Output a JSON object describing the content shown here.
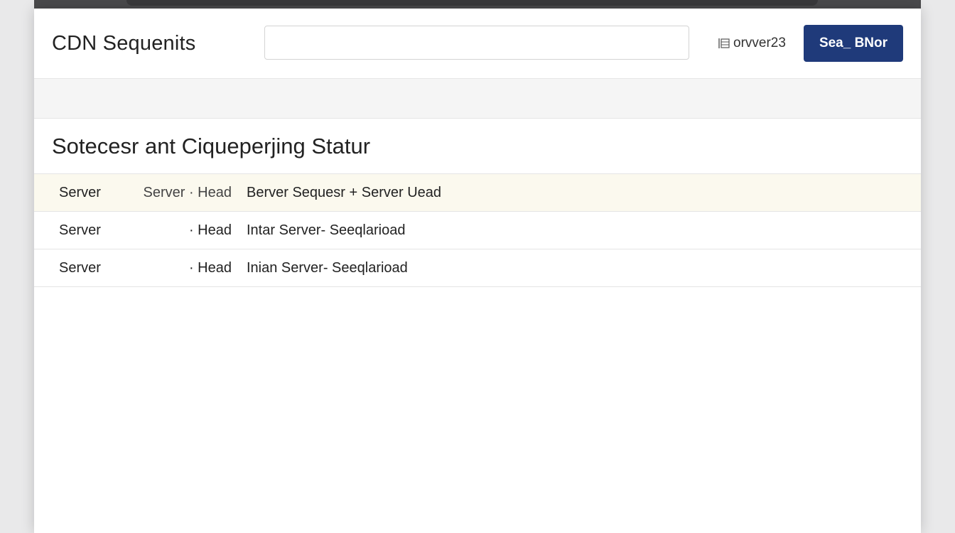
{
  "app": {
    "title": "CDN Sequenits"
  },
  "header": {
    "search_value": "",
    "server_label": "orvver23",
    "server_icon": "server-icon",
    "primary_button_label": "Sea_ BNor"
  },
  "section": {
    "title": "Sotecesr ant Ciqueperjing Statur"
  },
  "table": {
    "rows": [
      {
        "col1": "Server",
        "col2": "Server · Head",
        "col3": "Berver Sequesr + Server  Uead",
        "highlight": true
      },
      {
        "col1": "Server",
        "col2": "· Head",
        "col3": "Intar Server- Seeqlarioad",
        "highlight": false
      },
      {
        "col1": "Server",
        "col2": "· Head",
        "col3": "Inian Server- Seeqlarioad",
        "highlight": false
      }
    ]
  },
  "colors": {
    "primary": "#1f3a7a",
    "highlight_row": "#fbf9ee",
    "background": "#e9e9ea"
  }
}
